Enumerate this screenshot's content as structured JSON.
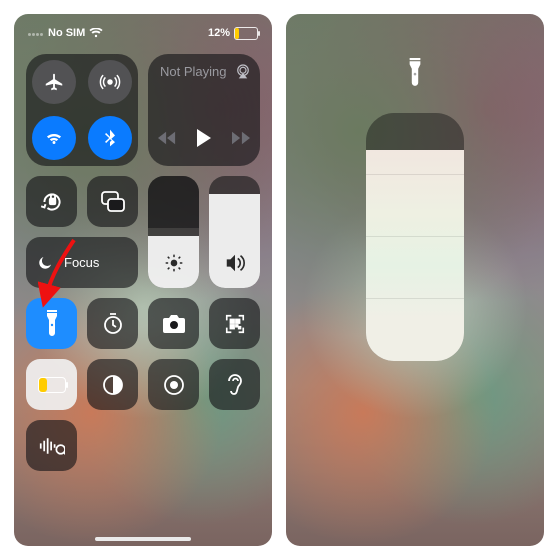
{
  "statusbar": {
    "carrier": "No SIM",
    "battery_pct": "12%"
  },
  "media": {
    "title": "Not Playing"
  },
  "focus": {
    "label": "Focus"
  },
  "icons": {
    "airplane": "airplane-icon",
    "cellular": "cellular-icon",
    "wifi": "wifi-icon",
    "bluetooth": "bluetooth-icon",
    "airplay": "airplay-icon",
    "lock": "orientation-lock-icon",
    "mirror": "screen-mirroring-icon",
    "moon": "moon-icon",
    "flashlight": "flashlight-icon",
    "timer": "timer-icon",
    "camera": "camera-icon",
    "qr": "qr-scanner-icon",
    "lowpower": "low-power-icon",
    "darkmode": "dark-mode-icon",
    "record": "screen-record-icon",
    "hearing": "hearing-icon",
    "shazam": "music-recognition-icon",
    "brightness": "brightness-icon",
    "volume": "volume-icon"
  },
  "sliders": {
    "brightness_pct": 46,
    "volume_pct": 85,
    "flashlight_level_pct": 85,
    "flashlight_steps": 4
  },
  "colors": {
    "active_blue": "#0a7bff",
    "battery_yellow": "#ffcc00"
  }
}
